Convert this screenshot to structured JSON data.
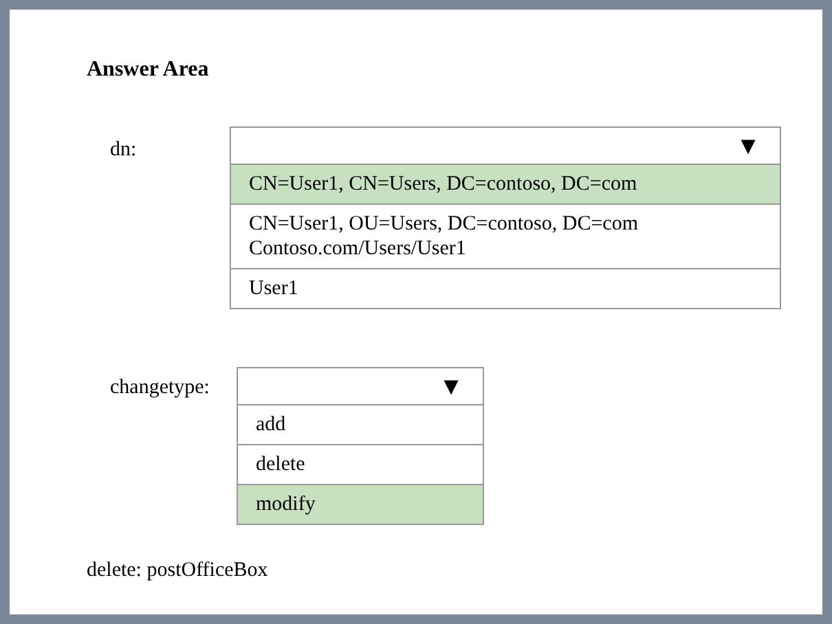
{
  "title": "Answer Area",
  "fields": [
    {
      "label": "dn:",
      "arrow": "▼",
      "options": [
        {
          "lines": [
            "CN=User1, CN=Users, DC=contoso, DC=com"
          ],
          "selected": true
        },
        {
          "lines": [
            "CN=User1, OU=Users, DC=contoso, DC=com",
            "Contoso.com/Users/User1"
          ],
          "selected": false
        },
        {
          "lines": [
            "User1"
          ],
          "selected": false
        }
      ]
    },
    {
      "label": "changetype:",
      "arrow": "▼",
      "options": [
        {
          "lines": [
            "add"
          ],
          "selected": false
        },
        {
          "lines": [
            "delete"
          ],
          "selected": false
        },
        {
          "lines": [
            "modify"
          ],
          "selected": true
        }
      ]
    }
  ],
  "footer": "delete: postOfficeBox"
}
